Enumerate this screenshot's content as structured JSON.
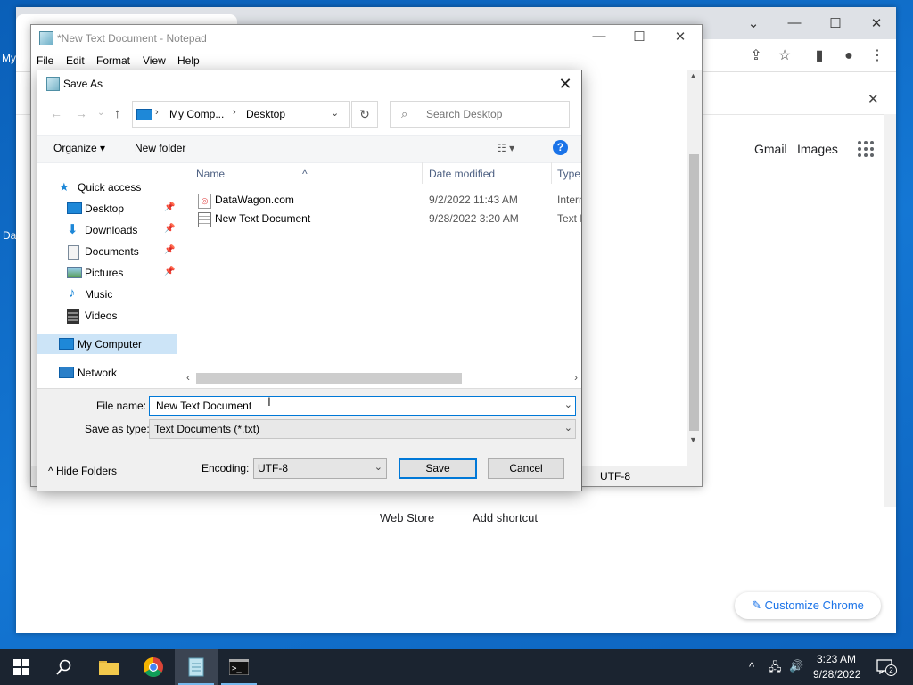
{
  "desktop": {
    "frag1": "My",
    "frag2": "Da"
  },
  "chrome": {
    "controls": {
      "tabsearch": "⌄",
      "minimize": "—",
      "maximize": "☐",
      "close": "✕"
    },
    "toolbar": {
      "share": "⇪",
      "star": "☆",
      "sidepanel": "▮",
      "profile": "●",
      "menu": "⋮"
    },
    "infobar_close": "✕",
    "links": {
      "gmail": "Gmail",
      "images": "Images"
    },
    "shortcuts": [
      {
        "label": "Web Store"
      },
      {
        "label": "Add shortcut"
      }
    ],
    "customize": "Customize Chrome"
  },
  "notepad": {
    "title": "*New Text Document - Notepad",
    "menu": [
      "File",
      "Edit",
      "Format",
      "View",
      "Help"
    ],
    "controls": {
      "minimize": "—",
      "maximize": "☐",
      "close": "✕"
    },
    "status": {
      "encoding": "UTF-8"
    }
  },
  "dialog": {
    "title": "Save As",
    "close": "✕",
    "nav": {
      "back": "←",
      "forward": "→",
      "up": "↑",
      "recent": "⌄"
    },
    "address": {
      "crumbs": [
        "My Comp...",
        "Desktop"
      ],
      "sep": "›",
      "dropdown": "⌄",
      "refresh": "↻"
    },
    "search": {
      "placeholder": "Search Desktop",
      "icon": "⌕"
    },
    "commands": {
      "organize": "Organize ▾",
      "new_folder": "New folder",
      "view": "☷ ▾",
      "help": "?"
    },
    "nav_pane": [
      {
        "label": "Quick access",
        "icon": "star-icon"
      },
      {
        "label": "Desktop",
        "icon": "desktop-icon",
        "pinned": true
      },
      {
        "label": "Downloads",
        "icon": "download-icon",
        "pinned": true
      },
      {
        "label": "Documents",
        "icon": "document-icon",
        "pinned": true
      },
      {
        "label": "Pictures",
        "icon": "picture-icon",
        "pinned": true
      },
      {
        "label": "Music",
        "icon": "music-icon"
      },
      {
        "label": "Videos",
        "icon": "video-icon"
      },
      {
        "label": "My Computer",
        "icon": "computer-icon",
        "selected": true
      },
      {
        "label": "Network",
        "icon": "network-icon"
      }
    ],
    "pin_glyph": "📌",
    "columns": {
      "name": "Name",
      "date": "Date modified",
      "type": "Type",
      "sort": "^"
    },
    "files": [
      {
        "name": "DataWagon.com",
        "date": "9/2/2022 11:43 AM",
        "type": "Internet Shortcut",
        "icon": "internet-shortcut-icon"
      },
      {
        "name": "New Text Document",
        "date": "9/28/2022 3:20 AM",
        "type": "Text Document",
        "icon": "text-file-icon"
      }
    ],
    "hscroll": {
      "left": "‹",
      "right": "›"
    },
    "file_name": {
      "label": "File name:",
      "value": "New Text Document",
      "dropdown": "⌄"
    },
    "save_as_type": {
      "label": "Save as type:",
      "value": "Text Documents (*.txt)",
      "dropdown": "⌄"
    },
    "hide_folders": "^  Hide Folders",
    "encoding": {
      "label": "Encoding:",
      "value": "UTF-8",
      "dropdown": "⌄"
    },
    "buttons": {
      "save": "Save",
      "cancel": "Cancel"
    }
  },
  "taskbar": {
    "items": [
      {
        "name": "start",
        "icon": "windows-icon"
      },
      {
        "name": "search",
        "icon": "search-icon"
      },
      {
        "name": "file-explorer",
        "icon": "folder-icon"
      },
      {
        "name": "chrome",
        "icon": "chrome-icon"
      },
      {
        "name": "notepad",
        "icon": "notepad-icon",
        "active": true
      },
      {
        "name": "terminal",
        "icon": "terminal-icon"
      }
    ],
    "tray": {
      "chevron": "^",
      "network": "🖧",
      "volume": "🔊"
    },
    "time": "3:23 AM",
    "date": "9/28/2022",
    "notifications": "2"
  },
  "colors": {
    "desktop": "#0a6cc8",
    "accent": "#0078d7",
    "taskbar": "#1b2430",
    "selection": "#cce4f7"
  }
}
